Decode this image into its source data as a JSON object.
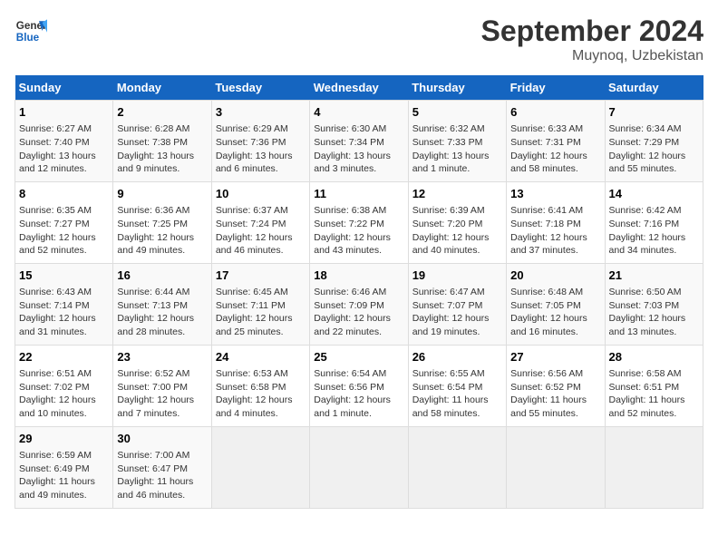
{
  "header": {
    "logo_line1": "General",
    "logo_line2": "Blue",
    "month": "September 2024",
    "location": "Muynoq, Uzbekistan"
  },
  "days_of_week": [
    "Sunday",
    "Monday",
    "Tuesday",
    "Wednesday",
    "Thursday",
    "Friday",
    "Saturday"
  ],
  "weeks": [
    [
      {
        "day": "1",
        "text": "Sunrise: 6:27 AM\nSunset: 7:40 PM\nDaylight: 13 hours\nand 12 minutes."
      },
      {
        "day": "2",
        "text": "Sunrise: 6:28 AM\nSunset: 7:38 PM\nDaylight: 13 hours\nand 9 minutes."
      },
      {
        "day": "3",
        "text": "Sunrise: 6:29 AM\nSunset: 7:36 PM\nDaylight: 13 hours\nand 6 minutes."
      },
      {
        "day": "4",
        "text": "Sunrise: 6:30 AM\nSunset: 7:34 PM\nDaylight: 13 hours\nand 3 minutes."
      },
      {
        "day": "5",
        "text": "Sunrise: 6:32 AM\nSunset: 7:33 PM\nDaylight: 13 hours\nand 1 minute."
      },
      {
        "day": "6",
        "text": "Sunrise: 6:33 AM\nSunset: 7:31 PM\nDaylight: 12 hours\nand 58 minutes."
      },
      {
        "day": "7",
        "text": "Sunrise: 6:34 AM\nSunset: 7:29 PM\nDaylight: 12 hours\nand 55 minutes."
      }
    ],
    [
      {
        "day": "8",
        "text": "Sunrise: 6:35 AM\nSunset: 7:27 PM\nDaylight: 12 hours\nand 52 minutes."
      },
      {
        "day": "9",
        "text": "Sunrise: 6:36 AM\nSunset: 7:25 PM\nDaylight: 12 hours\nand 49 minutes."
      },
      {
        "day": "10",
        "text": "Sunrise: 6:37 AM\nSunset: 7:24 PM\nDaylight: 12 hours\nand 46 minutes."
      },
      {
        "day": "11",
        "text": "Sunrise: 6:38 AM\nSunset: 7:22 PM\nDaylight: 12 hours\nand 43 minutes."
      },
      {
        "day": "12",
        "text": "Sunrise: 6:39 AM\nSunset: 7:20 PM\nDaylight: 12 hours\nand 40 minutes."
      },
      {
        "day": "13",
        "text": "Sunrise: 6:41 AM\nSunset: 7:18 PM\nDaylight: 12 hours\nand 37 minutes."
      },
      {
        "day": "14",
        "text": "Sunrise: 6:42 AM\nSunset: 7:16 PM\nDaylight: 12 hours\nand 34 minutes."
      }
    ],
    [
      {
        "day": "15",
        "text": "Sunrise: 6:43 AM\nSunset: 7:14 PM\nDaylight: 12 hours\nand 31 minutes."
      },
      {
        "day": "16",
        "text": "Sunrise: 6:44 AM\nSunset: 7:13 PM\nDaylight: 12 hours\nand 28 minutes."
      },
      {
        "day": "17",
        "text": "Sunrise: 6:45 AM\nSunset: 7:11 PM\nDaylight: 12 hours\nand 25 minutes."
      },
      {
        "day": "18",
        "text": "Sunrise: 6:46 AM\nSunset: 7:09 PM\nDaylight: 12 hours\nand 22 minutes."
      },
      {
        "day": "19",
        "text": "Sunrise: 6:47 AM\nSunset: 7:07 PM\nDaylight: 12 hours\nand 19 minutes."
      },
      {
        "day": "20",
        "text": "Sunrise: 6:48 AM\nSunset: 7:05 PM\nDaylight: 12 hours\nand 16 minutes."
      },
      {
        "day": "21",
        "text": "Sunrise: 6:50 AM\nSunset: 7:03 PM\nDaylight: 12 hours\nand 13 minutes."
      }
    ],
    [
      {
        "day": "22",
        "text": "Sunrise: 6:51 AM\nSunset: 7:02 PM\nDaylight: 12 hours\nand 10 minutes."
      },
      {
        "day": "23",
        "text": "Sunrise: 6:52 AM\nSunset: 7:00 PM\nDaylight: 12 hours\nand 7 minutes."
      },
      {
        "day": "24",
        "text": "Sunrise: 6:53 AM\nSunset: 6:58 PM\nDaylight: 12 hours\nand 4 minutes."
      },
      {
        "day": "25",
        "text": "Sunrise: 6:54 AM\nSunset: 6:56 PM\nDaylight: 12 hours\nand 1 minute."
      },
      {
        "day": "26",
        "text": "Sunrise: 6:55 AM\nSunset: 6:54 PM\nDaylight: 11 hours\nand 58 minutes."
      },
      {
        "day": "27",
        "text": "Sunrise: 6:56 AM\nSunset: 6:52 PM\nDaylight: 11 hours\nand 55 minutes."
      },
      {
        "day": "28",
        "text": "Sunrise: 6:58 AM\nSunset: 6:51 PM\nDaylight: 11 hours\nand 52 minutes."
      }
    ],
    [
      {
        "day": "29",
        "text": "Sunrise: 6:59 AM\nSunset: 6:49 PM\nDaylight: 11 hours\nand 49 minutes."
      },
      {
        "day": "30",
        "text": "Sunrise: 7:00 AM\nSunset: 6:47 PM\nDaylight: 11 hours\nand 46 minutes."
      },
      {
        "day": "",
        "text": ""
      },
      {
        "day": "",
        "text": ""
      },
      {
        "day": "",
        "text": ""
      },
      {
        "day": "",
        "text": ""
      },
      {
        "day": "",
        "text": ""
      }
    ]
  ]
}
